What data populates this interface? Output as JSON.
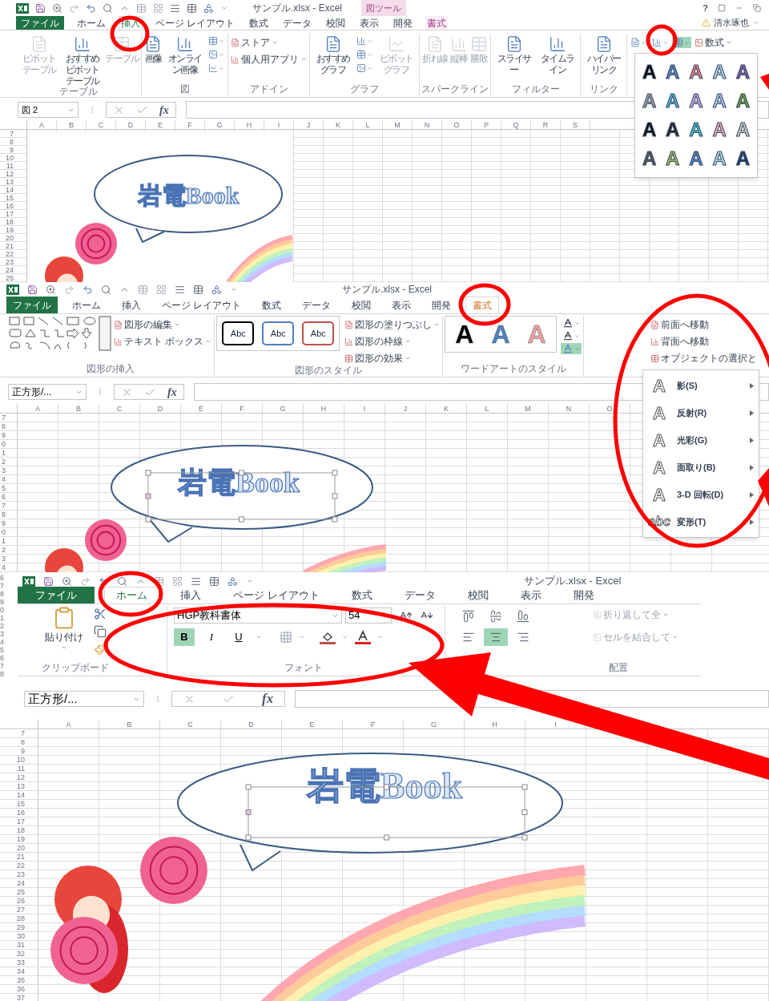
{
  "panels": [
    {
      "kind": "insert",
      "title": "サンプル.xlsx - Excel",
      "context_tab": "図ツール",
      "help": "?",
      "user": "清水琢也",
      "tabs": [
        {
          "label": "ファイル",
          "kind": "file",
          "selected": false
        },
        {
          "label": "ホーム",
          "kind": "normal",
          "selected": false
        },
        {
          "label": "挿入",
          "kind": "normal",
          "selected": true
        },
        {
          "label": "ページ レイアウト",
          "kind": "normal",
          "selected": false
        },
        {
          "label": "数式",
          "kind": "normal",
          "selected": false
        },
        {
          "label": "データ",
          "kind": "normal",
          "selected": false
        },
        {
          "label": "校閲",
          "kind": "normal",
          "selected": false
        },
        {
          "label": "表示",
          "kind": "normal",
          "selected": false
        },
        {
          "label": "開発",
          "kind": "normal",
          "selected": false
        },
        {
          "label": "書式",
          "kind": "context",
          "selected": false
        }
      ],
      "ribbon": [
        {
          "kind": "buttons",
          "label": "テーブル",
          "items": [
            {
              "kind": "large",
              "label": "ピボットテーブル",
              "disabled": true,
              "selected": false
            },
            {
              "kind": "large",
              "label": "おすすめピボットテーブル",
              "disabled": false,
              "selected": false
            },
            {
              "kind": "large",
              "label": "テーブル",
              "disabled": true,
              "selected": false
            }
          ]
        },
        {
          "kind": "buttons",
          "label": "図",
          "items": [
            {
              "kind": "large",
              "label": "画像",
              "disabled": false,
              "selected": false
            },
            {
              "kind": "large",
              "label": "オンライン画像",
              "disabled": false,
              "selected": false
            },
            {
              "kind": "icon",
              "disabled": false,
              "selected": false
            },
            {
              "kind": "icon",
              "disabled": false,
              "selected": false
            },
            {
              "kind": "icon",
              "disabled": false,
              "selected": false
            }
          ]
        },
        {
          "kind": "buttons",
          "label": "アドイン",
          "items": [
            {
              "kind": "small",
              "label": "ストア",
              "disabled": false,
              "selected": false
            },
            {
              "kind": "small",
              "label": "個人用アプリ",
              "disabled": false,
              "selected": false
            }
          ]
        },
        {
          "kind": "buttons",
          "label": "グラフ",
          "items": [
            {
              "kind": "large",
              "label": "おすすめグラフ",
              "disabled": false,
              "selected": false
            },
            {
              "kind": "icon",
              "disabled": false,
              "selected": false
            },
            {
              "kind": "icon",
              "disabled": false,
              "selected": false
            },
            {
              "kind": "icon",
              "disabled": false,
              "selected": false
            },
            {
              "kind": "large",
              "label": "ピボットグラフ",
              "disabled": true,
              "selected": false
            }
          ]
        },
        {
          "kind": "buttons",
          "label": "スパークライン",
          "items": [
            {
              "kind": "large",
              "label": "折れ線",
              "disabled": true,
              "selected": false
            },
            {
              "kind": "large",
              "label": "縦棒",
              "disabled": true,
              "selected": false
            },
            {
              "kind": "large",
              "label": "勝敗",
              "disabled": true,
              "selected": false
            }
          ]
        },
        {
          "kind": "buttons",
          "label": "フィルター",
          "items": [
            {
              "kind": "large",
              "label": "スライサー",
              "disabled": false,
              "selected": false
            },
            {
              "kind": "large",
              "label": "タイムライン",
              "disabled": false,
              "selected": false
            }
          ]
        },
        {
          "kind": "buttons",
          "label": "リンク",
          "items": [
            {
              "kind": "large",
              "label": "ハイパーリンク",
              "disabled": false,
              "selected": false
            }
          ]
        },
        {
          "kind": "toolbar",
          "items": [
            {
              "kind": "icon",
              "disabled": false,
              "selected": false
            },
            {
              "kind": "icon",
              "disabled": false,
              "selected": false
            },
            {
              "kind": "icon",
              "disabled": false,
              "selected": true
            },
            {
              "kind": "small",
              "label": "数式",
              "disabled": false,
              "selected": false
            }
          ]
        }
      ],
      "dropdown": {
        "kind": "gallery",
        "items": [
          {
            "text": "A",
            "color": "#000000"
          },
          {
            "text": "A",
            "color": "#4f81bd"
          },
          {
            "text": "A",
            "color": "#e07a7a"
          },
          {
            "text": "A",
            "color": "#a9d3e6"
          },
          {
            "text": "A",
            "color": "#7a5aa0"
          },
          {
            "text": "A",
            "color": "#9a9a9a"
          },
          {
            "text": "A",
            "color": "#4bacc6"
          },
          {
            "text": "A",
            "color": "#b8a5d6"
          },
          {
            "text": "A",
            "color": "#a8c4ea"
          },
          {
            "text": "A",
            "color": "#6a9a3a"
          },
          {
            "text": "A",
            "color": "#111111"
          },
          {
            "text": "A",
            "color": "#2a2a2a"
          },
          {
            "text": "A",
            "color": "#3db5c0"
          },
          {
            "text": "A",
            "color": "#e8a8a8"
          },
          {
            "text": "A",
            "color": "#c8c8bc"
          },
          {
            "text": "A",
            "color": "#555555"
          },
          {
            "text": "A",
            "color": "#9bbb59"
          },
          {
            "text": "A",
            "color": "#4f81bd"
          },
          {
            "text": "A",
            "color": "#a6d6e3"
          },
          {
            "text": "A",
            "color": "#1f3d6b"
          }
        ]
      },
      "name_box": "図 2",
      "function_label": "fx",
      "columns": [
        "A",
        "B",
        "C",
        "D",
        "E",
        "F",
        "G",
        "H",
        "I",
        "J",
        "K",
        "L",
        "M",
        "N",
        "O",
        "P",
        "Q",
        "R",
        "S"
      ],
      "rows": [
        "7",
        "8",
        "9",
        "10",
        "11",
        "12",
        "13",
        "14",
        "15",
        "16",
        "17",
        "18",
        "19",
        "20",
        "21",
        "22",
        "23",
        "24",
        "25"
      ],
      "wordart": "岩電Book",
      "selected_shape": false
    },
    {
      "kind": "format",
      "title": "サンプル.xlsx - Excel",
      "tabs": [
        {
          "label": "ファイル",
          "kind": "file",
          "selected": false
        },
        {
          "label": "ホーム",
          "kind": "normal",
          "selected": false
        },
        {
          "label": "挿入",
          "kind": "normal",
          "selected": false
        },
        {
          "label": "ページ レイアウト",
          "kind": "normal",
          "selected": false
        },
        {
          "label": "数式",
          "kind": "normal",
          "selected": false
        },
        {
          "label": "データ",
          "kind": "normal",
          "selected": false
        },
        {
          "label": "校閲",
          "kind": "normal",
          "selected": false
        },
        {
          "label": "表示",
          "kind": "normal",
          "selected": false
        },
        {
          "label": "開発",
          "kind": "normal",
          "selected": false
        },
        {
          "label": "書式",
          "kind": "context",
          "selected": true
        }
      ],
      "ribbon": [
        {
          "kind": "shapes",
          "label": "図形の挿入",
          "items": [
            {
              "kind": "small",
              "label": "図形の編集",
              "disabled": false,
              "selected": false
            },
            {
              "kind": "small",
              "label": "テキスト ボックス",
              "disabled": false,
              "selected": false
            }
          ]
        },
        {
          "kind": "styles",
          "label": "図形のスタイル",
          "swatches": [
            {
              "text": "Abc",
              "color": "#000000"
            },
            {
              "text": "Abc",
              "color": "#4f81bd"
            },
            {
              "text": "Abc",
              "color": "#c0504d"
            }
          ],
          "items": [
            {
              "kind": "small",
              "label": "図形の塗りつぶし",
              "disabled": false,
              "selected": false
            },
            {
              "kind": "small",
              "label": "図形の枠線",
              "disabled": false,
              "selected": false
            },
            {
              "kind": "small",
              "label": "図形の効果",
              "disabled": false,
              "selected": false
            }
          ]
        },
        {
          "kind": "wordart",
          "label": "ワードアートのスタイル",
          "swatches": [
            {
              "text": "A",
              "color": "#000000"
            },
            {
              "text": "A",
              "color": "#4f81bd"
            },
            {
              "text": "A",
              "color": "#e8a0a0"
            }
          ],
          "items": [
            {
              "kind": "icon",
              "disabled": false,
              "selected": false
            },
            {
              "kind": "icon",
              "disabled": false,
              "selected": false
            },
            {
              "kind": "icon",
              "disabled": false,
              "selected": true
            }
          ]
        },
        {
          "kind": "toolbar",
          "items": [
            {
              "kind": "small",
              "label": "前面へ移動",
              "disabled": false,
              "selected": false
            },
            {
              "kind": "small",
              "label": "背面へ移動",
              "disabled": false,
              "selected": false
            },
            {
              "kind": "small",
              "label": "オブジェクトの選択と",
              "disabled": false,
              "selected": false
            }
          ]
        }
      ],
      "dropdown": {
        "kind": "menu",
        "items": [
          {
            "icon_text": "A",
            "label": "影(S)"
          },
          {
            "icon_text": "A",
            "label": "反射(R)"
          },
          {
            "icon_text": "A",
            "label": "光彩(G)"
          },
          {
            "icon_text": "A",
            "label": "面取り(B)"
          },
          {
            "icon_text": "A",
            "label": "3-D 回転(D)"
          },
          {
            "icon_text": "abc",
            "label": "変形(T)"
          }
        ]
      },
      "name_box": "正方形/...",
      "function_label": "fx",
      "columns": [
        "A",
        "B",
        "C",
        "D",
        "E",
        "F",
        "G",
        "H",
        "I",
        "J",
        "K",
        "L",
        "M",
        "N",
        "O"
      ],
      "rows": [
        "7",
        "8",
        "9",
        "0",
        "1",
        "2",
        "3",
        "4",
        "5",
        "6",
        "7",
        "8",
        "9",
        "0",
        "1",
        "2",
        "3",
        "4"
      ],
      "wordart": "岩電Book",
      "selected_shape": true
    },
    {
      "kind": "home",
      "title": "サンプル.xlsx - Excel",
      "underlay_rows": [
        "6",
        "7",
        "8",
        "9",
        "0",
        "1",
        "2",
        "3",
        "4",
        "5",
        "6",
        "7",
        "8"
      ],
      "tabs": [
        {
          "label": "ファイル",
          "kind": "file",
          "selected": false
        },
        {
          "label": "ホーム",
          "kind": "normal",
          "selected": true
        },
        {
          "label": "挿入",
          "kind": "normal",
          "selected": false
        },
        {
          "label": "ページ レイアウト",
          "kind": "normal",
          "selected": false
        },
        {
          "label": "数式",
          "kind": "normal",
          "selected": false
        },
        {
          "label": "データ",
          "kind": "normal",
          "selected": false
        },
        {
          "label": "校閲",
          "kind": "normal",
          "selected": false
        },
        {
          "label": "表示",
          "kind": "normal",
          "selected": false
        },
        {
          "label": "開発",
          "kind": "normal",
          "selected": false
        }
      ],
      "ribbon": [
        {
          "kind": "clipboard",
          "label": "クリップボード",
          "items": [
            {
              "kind": "large",
              "label": "貼り付け",
              "disabled": false,
              "selected": false
            }
          ]
        },
        {
          "kind": "font",
          "label": "フォント",
          "font": "HGP教科書体",
          "size": "54",
          "styles": [
            {
              "text": "B",
              "selected": true
            },
            {
              "text": "I",
              "selected": false
            },
            {
              "text": "U",
              "selected": false
            }
          ]
        },
        {
          "kind": "align",
          "label": "配置",
          "aligns": [
            {
              "selected": false
            },
            {
              "selected": false
            },
            {
              "selected": false
            },
            {
              "selected": false
            },
            {
              "selected": true
            },
            {
              "selected": false
            }
          ],
          "items": [
            {
              "kind": "small",
              "label": "折り返して全",
              "disabled": true,
              "selected": false
            },
            {
              "kind": "small",
              "label": "セルを結合して",
              "disabled": true,
              "selected": false
            }
          ]
        }
      ],
      "name_box": "正方形/...",
      "function_label": "fx",
      "columns": [
        "A",
        "B",
        "C",
        "D",
        "E",
        "F",
        "G",
        "H",
        "I"
      ],
      "rows": [
        "7",
        "8",
        "9",
        "10",
        "11",
        "12",
        "13",
        "14",
        "15",
        "16",
        "17",
        "18",
        "19",
        "20",
        "21",
        "22",
        "23",
        "24",
        "25",
        "26",
        "27",
        "28",
        "29",
        "30",
        "31",
        "32",
        "33",
        "34",
        "35",
        "36",
        "37"
      ],
      "wordart": "岩電Book",
      "selected_shape": true
    }
  ]
}
